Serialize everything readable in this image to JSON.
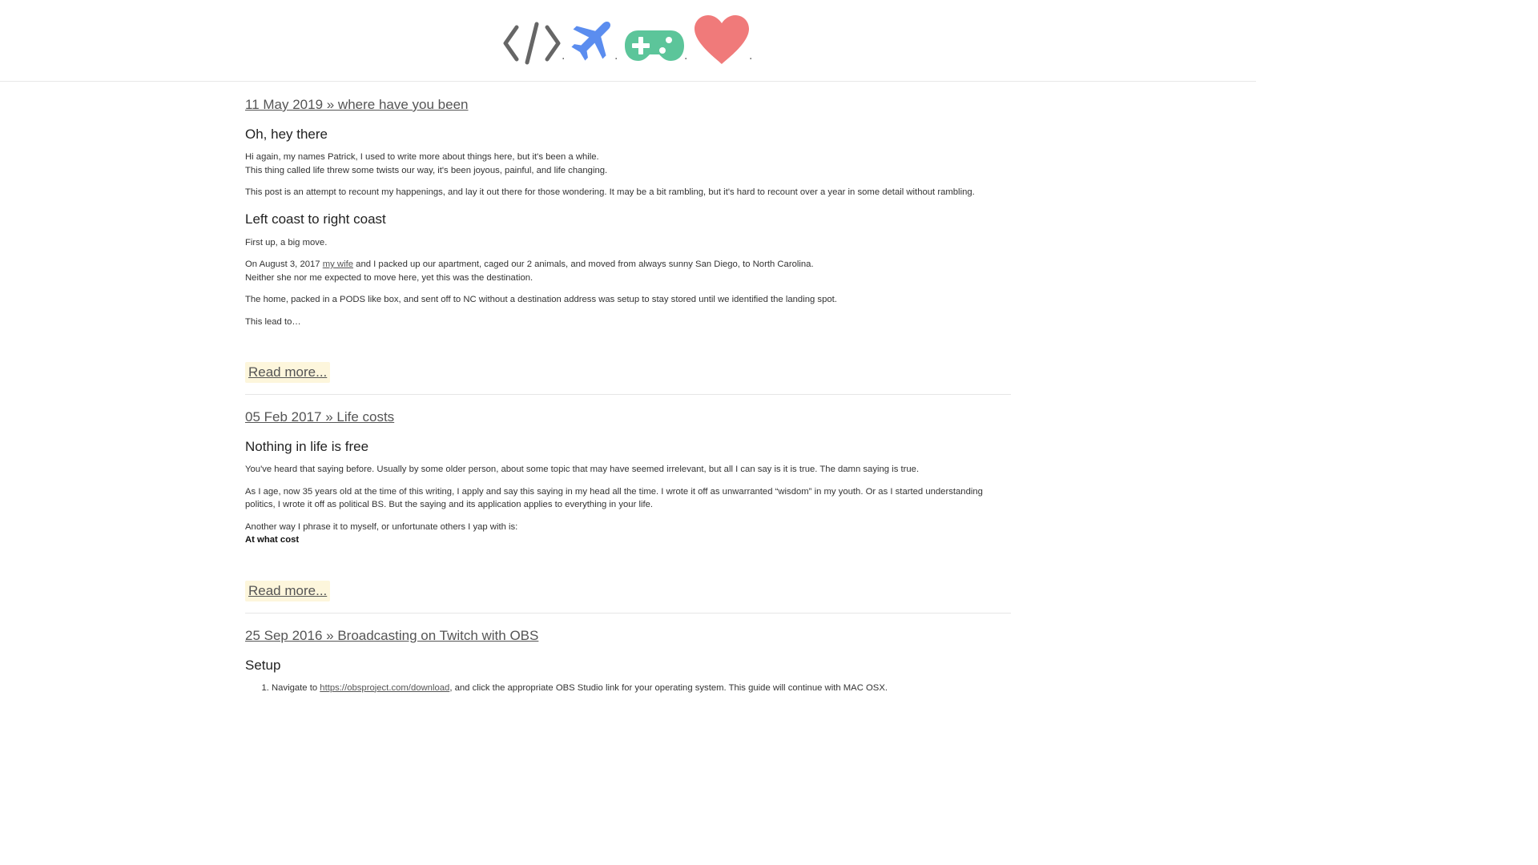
{
  "header": {
    "icons": [
      "code-icon",
      "airplane-icon",
      "gamepad-icon",
      "heart-icon"
    ],
    "dots": [
      ".",
      ".",
      ".",
      "."
    ],
    "colors": {
      "code": "#666666",
      "airplane": "#5b8def",
      "gamepad": "#5cc59a",
      "heart": "#f07a7a"
    }
  },
  "posts": [
    {
      "title": "11 May 2019 » where have you been",
      "sections": [
        {
          "heading": "Oh, hey there",
          "paragraphs": [
            [
              "Hi again, my names Patrick, I used to write more about things here, but it's been a while.",
              "This thing called life threw some twists our way, it's been joyous, painful, and life changing."
            ],
            [
              "This post is an attempt to recount my happenings, and lay it out there for those wondering. It may be a bit rambling, but it's hard to recount over a year in some detail without rambling."
            ]
          ]
        },
        {
          "heading": "Left coast to right coast",
          "p1": "First up, a big move.",
          "p2_pre": "On August 3, 2017 ",
          "p2_link": "my wife",
          "p2_post": " and I packed up our apartment, caged our 2 animals, and moved from always sunny San Diego, to North Carolina.",
          "p2_line2": "Neither she nor me expected to move here, yet this was the destination.",
          "p3": "The home, packed in a PODS like box, and sent off to NC without a destination address was setup to stay stored until we identified the landing spot.",
          "p4": "This lead to…"
        }
      ],
      "read_more": "Read more..."
    },
    {
      "title": "05 Feb 2017 » Life costs",
      "heading": "Nothing in life is free",
      "p1": "You've heard that saying before. Usually by some older person, about some topic that may have seemed irrelevant, but all I can say is it is true. The damn saying is true.",
      "p2": "As I age, now 35 years old at the time of this writing, I apply and say this saying in my head all the time. I wrote it off as unwarranted “wisdom” in my youth. Or as I started understanding politics, I wrote it off as political BS. But the saying and its application applies to everything in your life.",
      "p3": "Another way I phrase it to myself, or unfortunate others I yap with is:",
      "p3_bold": "At what cost",
      "read_more": "Read more..."
    },
    {
      "title": "25 Sep 2016 » Broadcasting on Twitch with OBS",
      "heading": "Setup",
      "li1_pre": "Navigate to ",
      "li1_link": "https://obsproject.com/download",
      "li1_post": ", and click the appropriate OBS Studio link for your operating system. This guide will continue with MAC OSX."
    }
  ]
}
